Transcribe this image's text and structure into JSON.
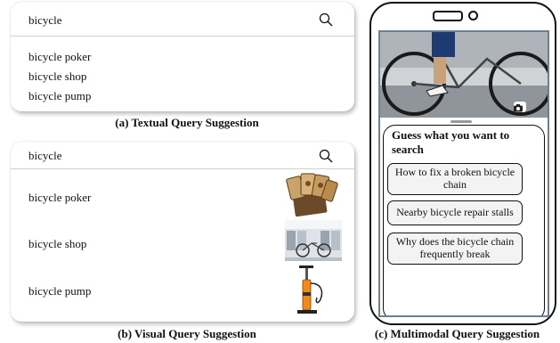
{
  "textual": {
    "query": "bicycle",
    "suggestions": [
      "bicycle poker",
      "bicycle shop",
      "bicycle pump"
    ],
    "caption": "(a) Textual Query Suggestion"
  },
  "visual": {
    "query": "bicycle",
    "suggestions": [
      "bicycle poker",
      "bicycle shop",
      "bicycle pump"
    ],
    "caption": "(b) Visual Query Suggestion"
  },
  "multimodal": {
    "prompt_title": "Guess what you want to search",
    "options": [
      "How to fix a broken bicycle chain",
      "Nearby bicycle repair stalls",
      "Why does the bicycle chain frequently break"
    ],
    "caption": "(c) Multimodal Query Suggestion"
  },
  "icons": {
    "search": "search-icon",
    "camera": "camera-icon"
  }
}
